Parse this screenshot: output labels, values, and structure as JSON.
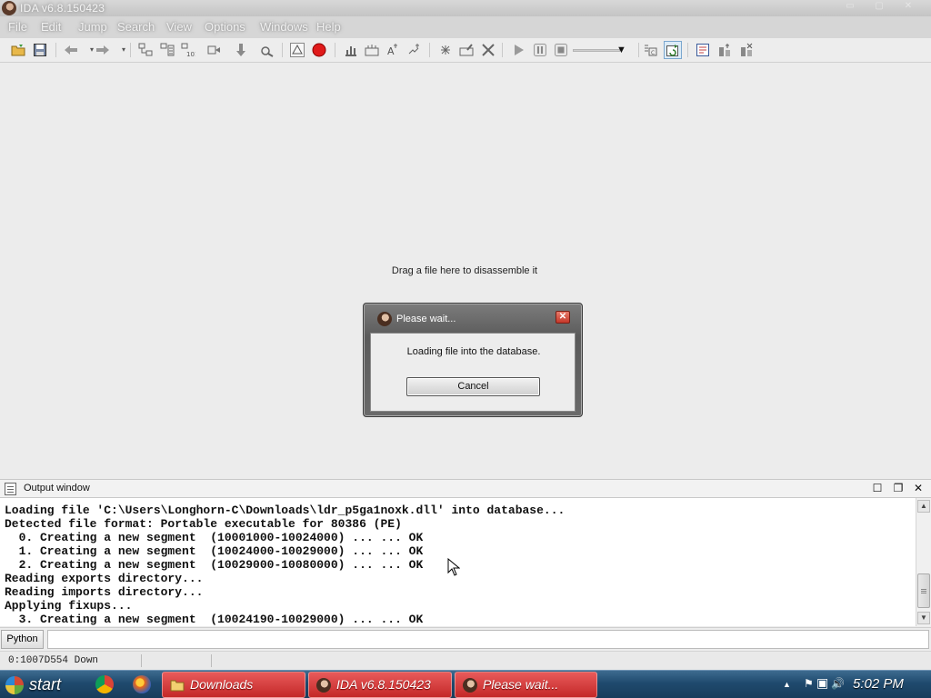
{
  "window": {
    "title": "IDA v6.8.150423",
    "controls": {
      "minimize": "▭",
      "maximize": "▢",
      "close": "✕"
    }
  },
  "menu": [
    "File",
    "Edit",
    "Jump",
    "Search",
    "View",
    "Options",
    "Windows",
    "Help"
  ],
  "main": {
    "drop_hint": "Drag a file here to disassemble it"
  },
  "dialog": {
    "title": "Please wait...",
    "message": "Loading file into the database.",
    "cancel_label": "Cancel"
  },
  "output": {
    "title": "Output window",
    "lines": [
      "Loading file 'C:\\Users\\Longhorn-C\\Downloads\\ldr_p5ga1noxk.dll' into database...",
      "Detected file format: Portable executable for 80386 (PE)",
      "  0. Creating a new segment  (10001000-10024000) ... ... OK",
      "  1. Creating a new segment  (10024000-10029000) ... ... OK",
      "  2. Creating a new segment  (10029000-10080000) ... ... OK",
      "Reading exports directory...",
      "Reading imports directory...",
      "Applying fixups...",
      "  3. Creating a new segment  (10024190-10029000) ... ... OK"
    ]
  },
  "python_bar": {
    "button_label": "Python"
  },
  "statusbar": {
    "address": "0:1007D554",
    "direction": "Down"
  },
  "taskbar": {
    "start_label": "start",
    "tasks": [
      {
        "label": "Downloads"
      },
      {
        "label": "IDA v6.8.150423"
      },
      {
        "label": "Please wait..."
      }
    ],
    "clock": "5:02 PM"
  },
  "colors": {
    "accent_red": "#d03030",
    "taskbar_blue": "#1f4a6e"
  }
}
